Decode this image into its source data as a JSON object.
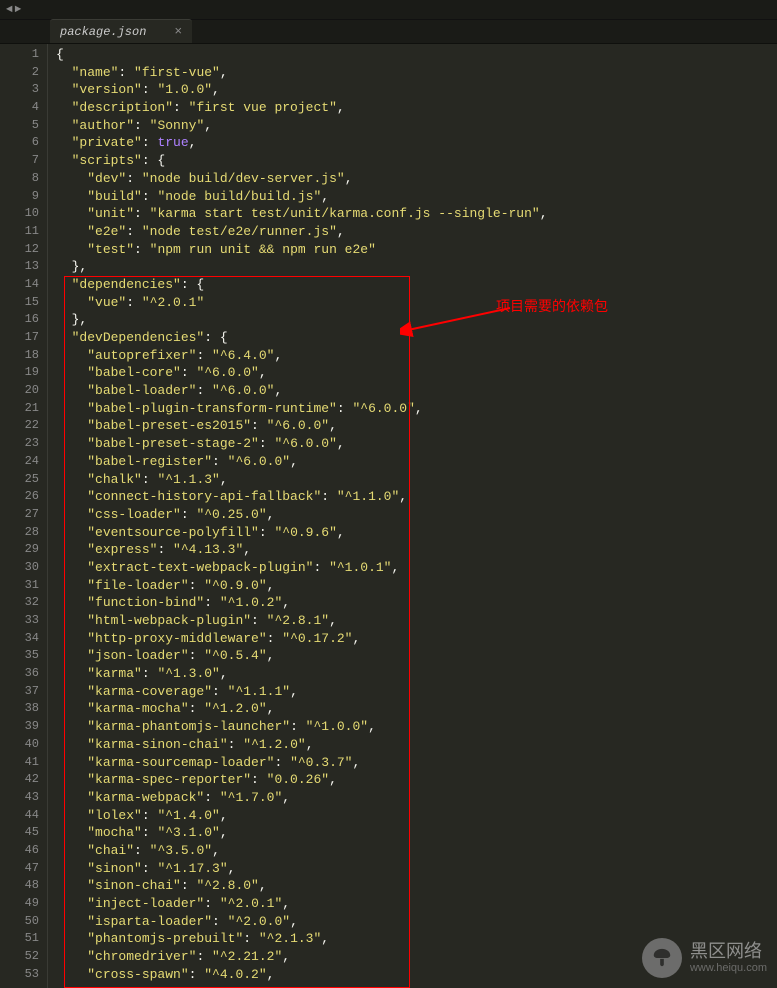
{
  "tab": {
    "title": "package.json",
    "close": "×"
  },
  "nav": {
    "left": "◄",
    "right": "►"
  },
  "annotation": "项目需要的依赖包",
  "watermark": {
    "title": "黑区网络",
    "url": "www.heiqu.com"
  },
  "code": {
    "name_k": "name",
    "name_v": "first-vue",
    "version_k": "version",
    "version_v": "1.0.0",
    "description_k": "description",
    "description_v": "first vue project",
    "author_k": "author",
    "author_v": "Sonny",
    "private_k": "private",
    "private_v": "true",
    "scripts_k": "scripts",
    "s_dev_k": "dev",
    "s_dev_v": "node build/dev-server.js",
    "s_build_k": "build",
    "s_build_v": "node build/build.js",
    "s_unit_k": "unit",
    "s_unit_v": "karma start test/unit/karma.conf.js --single-run",
    "s_e2e_k": "e2e",
    "s_e2e_v": "node test/e2e/runner.js",
    "s_test_k": "test",
    "s_test_v": "npm run unit && npm run e2e",
    "dependencies_k": "dependencies",
    "d_vue_k": "vue",
    "d_vue_v": "^2.0.1",
    "devDependencies_k": "devDependencies",
    "dd": [
      {
        "k": "autoprefixer",
        "v": "^6.4.0"
      },
      {
        "k": "babel-core",
        "v": "^6.0.0"
      },
      {
        "k": "babel-loader",
        "v": "^6.0.0"
      },
      {
        "k": "babel-plugin-transform-runtime",
        "v": "^6.0.0"
      },
      {
        "k": "babel-preset-es2015",
        "v": "^6.0.0"
      },
      {
        "k": "babel-preset-stage-2",
        "v": "^6.0.0"
      },
      {
        "k": "babel-register",
        "v": "^6.0.0"
      },
      {
        "k": "chalk",
        "v": "^1.1.3"
      },
      {
        "k": "connect-history-api-fallback",
        "v": "^1.1.0"
      },
      {
        "k": "css-loader",
        "v": "^0.25.0"
      },
      {
        "k": "eventsource-polyfill",
        "v": "^0.9.6"
      },
      {
        "k": "express",
        "v": "^4.13.3"
      },
      {
        "k": "extract-text-webpack-plugin",
        "v": "^1.0.1"
      },
      {
        "k": "file-loader",
        "v": "^0.9.0"
      },
      {
        "k": "function-bind",
        "v": "^1.0.2"
      },
      {
        "k": "html-webpack-plugin",
        "v": "^2.8.1"
      },
      {
        "k": "http-proxy-middleware",
        "v": "^0.17.2"
      },
      {
        "k": "json-loader",
        "v": "^0.5.4"
      },
      {
        "k": "karma",
        "v": "^1.3.0"
      },
      {
        "k": "karma-coverage",
        "v": "^1.1.1"
      },
      {
        "k": "karma-mocha",
        "v": "^1.2.0"
      },
      {
        "k": "karma-phantomjs-launcher",
        "v": "^1.0.0"
      },
      {
        "k": "karma-sinon-chai",
        "v": "^1.2.0"
      },
      {
        "k": "karma-sourcemap-loader",
        "v": "^0.3.7"
      },
      {
        "k": "karma-spec-reporter",
        "v": "0.0.26"
      },
      {
        "k": "karma-webpack",
        "v": "^1.7.0"
      },
      {
        "k": "lolex",
        "v": "^1.4.0"
      },
      {
        "k": "mocha",
        "v": "^3.1.0"
      },
      {
        "k": "chai",
        "v": "^3.5.0"
      },
      {
        "k": "sinon",
        "v": "^1.17.3"
      },
      {
        "k": "sinon-chai",
        "v": "^2.8.0"
      },
      {
        "k": "inject-loader",
        "v": "^2.0.1"
      },
      {
        "k": "isparta-loader",
        "v": "^2.0.0"
      },
      {
        "k": "phantomjs-prebuilt",
        "v": "^2.1.3"
      },
      {
        "k": "chromedriver",
        "v": "^2.21.2"
      },
      {
        "k": "cross-spawn",
        "v": "^4.0.2"
      }
    ]
  },
  "lines_total": 53
}
